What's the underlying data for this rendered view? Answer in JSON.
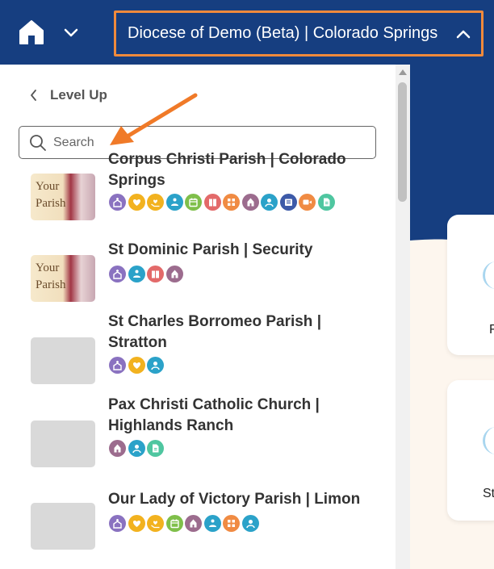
{
  "header": {
    "org_title": "Diocese of Demo (Beta) | Colorado Springs",
    "bg_color": "#163e80",
    "highlight_color": "#f08a3c"
  },
  "panel": {
    "level_up_label": "Level Up",
    "search_placeholder": "Search"
  },
  "background_cards": [
    "F",
    "St"
  ],
  "icon_colors": {
    "purple": "#8a72c0",
    "yellow": "#f2b21f",
    "teal": "#2ba2c9",
    "green": "#7fbf4a",
    "coral": "#e36a6a",
    "orange": "#f08b43",
    "mauve": "#9c6c8e",
    "navy": "#3d5aa8",
    "mint": "#4fc6a0"
  },
  "parishes": [
    {
      "name": "Corpus Christi Parish | Colorado Springs",
      "thumbnail_text": [
        "Your",
        "Parish"
      ],
      "icons": [
        "church-icon",
        "heart-icon",
        "heart-hands-icon",
        "people-icon",
        "calendar-icon",
        "book-icon",
        "grid-icon",
        "chapel-icon",
        "user-icon",
        "news-icon",
        "video-icon",
        "document-icon"
      ]
    },
    {
      "name": "St Dominic Parish | Security",
      "thumbnail_text": [
        "Your",
        "Parish"
      ],
      "icons": [
        "church-icon",
        "people-icon",
        "book-icon",
        "chapel-icon"
      ]
    },
    {
      "name": "St Charles Borromeo Parish | Stratton",
      "thumbnail_text": [],
      "icons": [
        "church-icon",
        "heart-icon",
        "user-icon"
      ]
    },
    {
      "name": "Pax Christi Catholic Church | Highlands Ranch",
      "thumbnail_text": [],
      "icons": [
        "chapel-icon",
        "user-icon",
        "document-icon"
      ]
    },
    {
      "name": "Our Lady of Victory Parish | Limon",
      "thumbnail_text": [],
      "icons": [
        "church-icon",
        "heart-icon",
        "heart-hands-icon",
        "calendar-icon",
        "chapel-icon",
        "people-icon",
        "grid-icon",
        "user-icon"
      ]
    }
  ]
}
